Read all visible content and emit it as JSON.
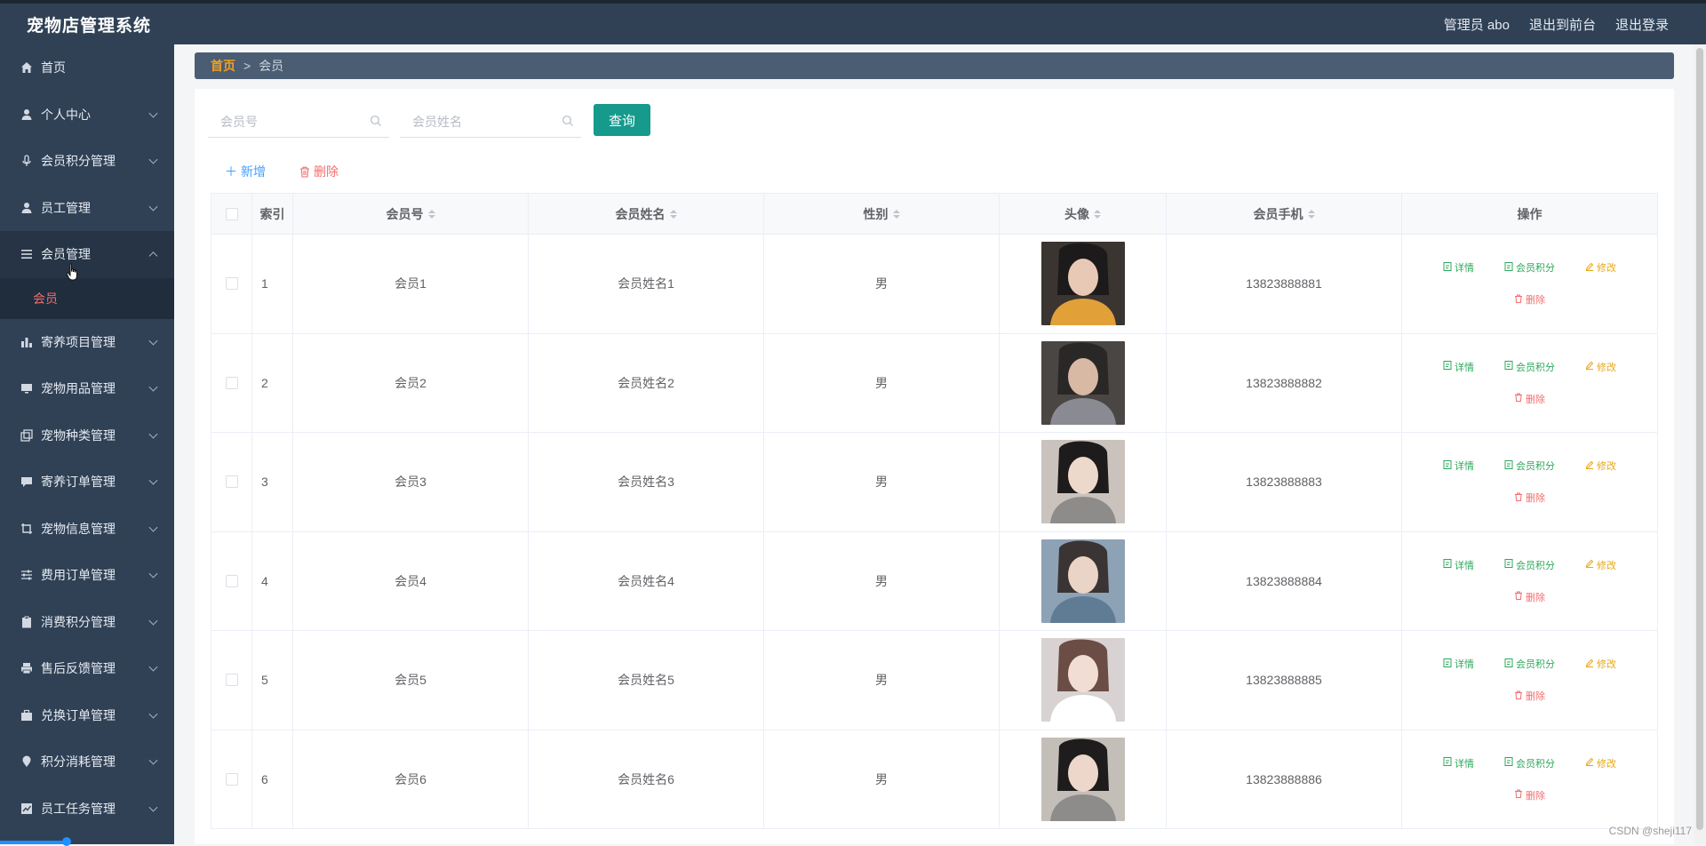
{
  "header": {
    "app_title": "宠物店管理系统",
    "admin_label": "管理员 abo",
    "front_label": "退出到前台",
    "logout_label": "退出登录"
  },
  "sidebar": {
    "items": [
      {
        "label": "首页",
        "icon": "home-icon",
        "has_children": false
      },
      {
        "label": "个人中心",
        "icon": "user-icon",
        "has_children": true
      },
      {
        "label": "会员积分管理",
        "icon": "microphone-icon",
        "has_children": true
      },
      {
        "label": "员工管理",
        "icon": "user-icon",
        "has_children": true
      },
      {
        "label": "会员管理",
        "icon": "menu-icon",
        "has_children": true,
        "open": true
      },
      {
        "label": "寄养项目管理",
        "icon": "bar-chart-icon",
        "has_children": true
      },
      {
        "label": "宠物用品管理",
        "icon": "monitor-icon",
        "has_children": true
      },
      {
        "label": "宠物种类管理",
        "icon": "copy-icon",
        "has_children": true
      },
      {
        "label": "寄养订单管理",
        "icon": "chat-icon",
        "has_children": true
      },
      {
        "label": "宠物信息管理",
        "icon": "crop-icon",
        "has_children": true
      },
      {
        "label": "费用订单管理",
        "icon": "sliders-icon",
        "has_children": true
      },
      {
        "label": "消费积分管理",
        "icon": "clipboard-icon",
        "has_children": true
      },
      {
        "label": "售后反馈管理",
        "icon": "printer-icon",
        "has_children": true
      },
      {
        "label": "兑换订单管理",
        "icon": "briefcase-icon",
        "has_children": true
      },
      {
        "label": "积分消耗管理",
        "icon": "location-icon",
        "has_children": true
      },
      {
        "label": "员工任务管理",
        "icon": "trend-chart-icon",
        "has_children": true
      }
    ],
    "submenu_active": "会员"
  },
  "breadcrumb": {
    "home": "首页",
    "separator": ">",
    "current": "会员"
  },
  "search": {
    "member_no_placeholder": "会员号",
    "member_name_placeholder": "会员姓名",
    "query_label": "查询"
  },
  "actions": {
    "add_label": "新增",
    "delete_label": "删除"
  },
  "table": {
    "columns": {
      "index": "索引",
      "member_no": "会员号",
      "member_name": "会员姓名",
      "gender": "性别",
      "avatar": "头像",
      "phone": "会员手机",
      "ops": "操作"
    },
    "op_labels": {
      "detail": "详情",
      "points": "会员积分",
      "edit": "修改",
      "delete": "删除"
    },
    "rows": [
      {
        "index": "1",
        "member_no": "会员1",
        "member_name": "会员姓名1",
        "gender": "男",
        "phone": "13823888881"
      },
      {
        "index": "2",
        "member_no": "会员2",
        "member_name": "会员姓名2",
        "gender": "男",
        "phone": "13823888882"
      },
      {
        "index": "3",
        "member_no": "会员3",
        "member_name": "会员姓名3",
        "gender": "男",
        "phone": "13823888883"
      },
      {
        "index": "4",
        "member_no": "会员4",
        "member_name": "会员姓名4",
        "gender": "男",
        "phone": "13823888884"
      },
      {
        "index": "5",
        "member_no": "会员5",
        "member_name": "会员姓名5",
        "gender": "男",
        "phone": "13823888885"
      },
      {
        "index": "6",
        "member_no": "会员6",
        "member_name": "会员姓名6",
        "gender": "男",
        "phone": "13823888886"
      }
    ]
  },
  "watermark": "CSDN @sheji117",
  "colors": {
    "sidebar_bg": "#304156",
    "accent_teal": "#159a8c",
    "breadcrumb_home": "#f0a020",
    "submenu_active": "#f56c6c",
    "op_green": "#2ea85c",
    "op_yellow": "#e6a817",
    "op_red": "#f56c6c"
  }
}
